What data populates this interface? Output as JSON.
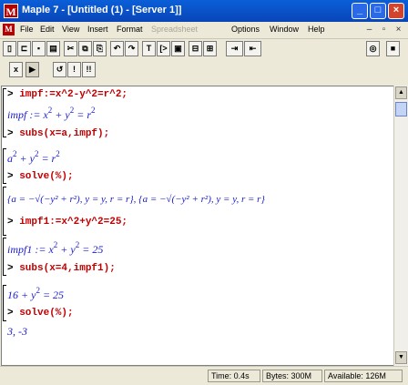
{
  "window": {
    "title": "Maple 7 - [Untitled (1) - [Server 1]]",
    "controls": {
      "minimize": "_",
      "maximize": "□",
      "close": "×"
    }
  },
  "menu": {
    "items": [
      "File",
      "Edit",
      "View",
      "Insert",
      "Format",
      "Spreadsheet",
      "Options",
      "Window",
      "Help"
    ],
    "disabled": "Spreadsheet",
    "mdi_controls": [
      "–",
      "▫",
      "×"
    ]
  },
  "toolbar1": {
    "buttons": [
      "new-file",
      "open-file",
      "save-file",
      "print",
      "cut",
      "copy",
      "paste",
      "undo",
      "redo",
      "insert-text",
      "insert-maple-input",
      "insert-execution-group",
      "collapse-section",
      "expand-section",
      "indent",
      "outdent",
      "help-lookup",
      "stop"
    ]
  },
  "toolbar2": {
    "buttons": [
      "execute-group",
      "palette",
      "restart",
      "zoom-100",
      "zoom-200"
    ],
    "labels": [
      "x",
      "▶",
      "!",
      "!!"
    ]
  },
  "worksheet": {
    "input1": "impf:=x^2-y^2=r^2;",
    "output1": {
      "lhs": "impf",
      "rhs_a": "x",
      "rhs_b": "y",
      "rhs_c": "r",
      "exp": "2"
    },
    "input2": "subs(x=a,impf);",
    "output2": {
      "a": "a",
      "b": "y",
      "c": "r",
      "exp": "2"
    },
    "input3": "solve(%);",
    "output3": "{a = −√(−y² + r²), y = y, r = r}, {a = −√(−y² + r²), y = y, r = r}",
    "input4": "impf1:=x^2+y^2=25;",
    "output4": {
      "lhs": "impf1",
      "a": "x",
      "b": "y",
      "rhs": "25",
      "exp": "2"
    },
    "input5": "subs(x=4,impf1);",
    "output5": {
      "lhs": "16",
      "b": "y",
      "rhs": "25",
      "exp": "2"
    },
    "input6": "solve(%);",
    "output6": "3, -3"
  },
  "status": {
    "time": "Time: 0.4s",
    "bytes": "Bytes: 300M",
    "available": "Available: 126M"
  }
}
